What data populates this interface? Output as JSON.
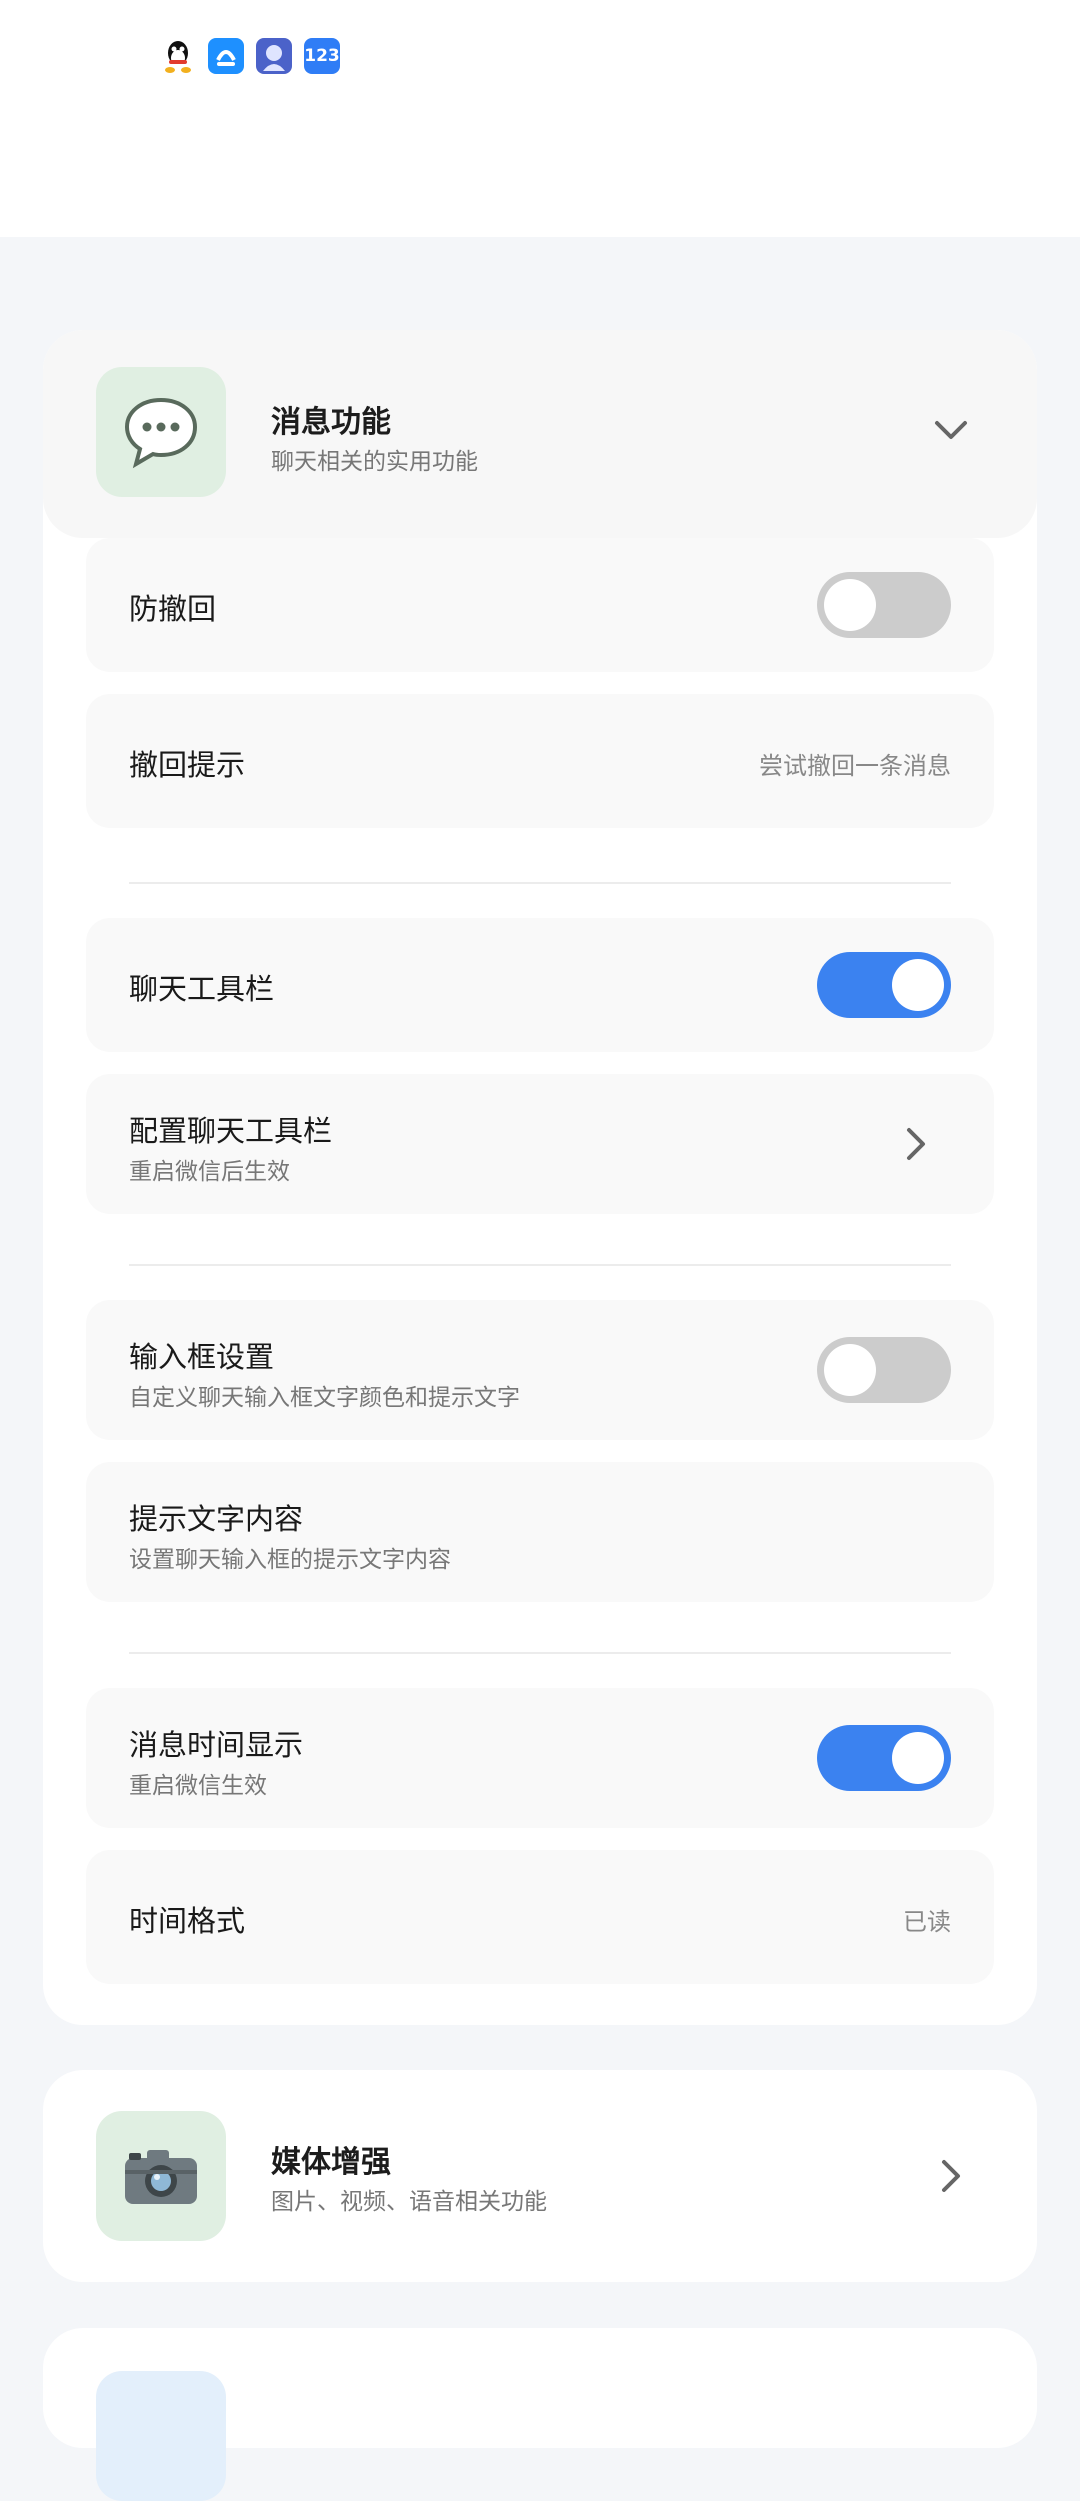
{
  "status_bar": {
    "icons": [
      "qq-icon",
      "alipay-icon",
      "avatar-icon",
      "123-icon"
    ],
    "num_label": "123"
  },
  "section_message": {
    "title": "消息功能",
    "subtitle": "聊天相关的实用功能",
    "icon": "speech-bubble-icon",
    "expanded": true,
    "rows": [
      {
        "title": "防撤回",
        "type": "toggle",
        "on": false
      },
      {
        "title": "撤回提示",
        "type": "value",
        "value": "尝试撤回一条消息"
      },
      {
        "title": "聊天工具栏",
        "type": "toggle",
        "on": true
      },
      {
        "title": "配置聊天工具栏",
        "subtitle": "重启微信后生效",
        "type": "link"
      },
      {
        "title": "输入框设置",
        "subtitle": "自定义聊天输入框文字颜色和提示文字",
        "type": "toggle",
        "on": false
      },
      {
        "title": "提示文字内容",
        "subtitle": "设置聊天输入框的提示文字内容",
        "type": "static"
      },
      {
        "title": "消息时间显示",
        "subtitle": "重启微信生效",
        "type": "toggle",
        "on": true
      },
      {
        "title": "时间格式",
        "type": "value",
        "value": "已读"
      }
    ]
  },
  "section_media": {
    "title": "媒体增强",
    "subtitle": "图片、视频、语音相关功能",
    "icon": "camera-icon"
  },
  "colors": {
    "accent": "#3b82f0",
    "toggle_off": "#cccccc",
    "icon_bg_green": "#e0efe2",
    "icon_bg_blue": "#e3effb"
  }
}
